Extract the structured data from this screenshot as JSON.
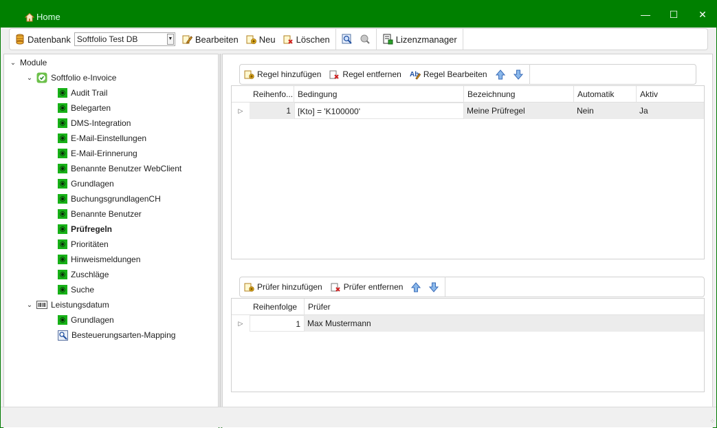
{
  "window": {
    "title": "Home",
    "minimize": "—",
    "maximize": "☐",
    "close": "✕"
  },
  "toolbar": {
    "datenbank_label": "Datenbank",
    "db_value": "Softfolio Test DB",
    "bearbeiten": "Bearbeiten",
    "neu": "Neu",
    "loeschen": "Löschen",
    "lizenzmanager": "Lizenzmanager"
  },
  "tree": {
    "root": "Module",
    "group1": "Softfolio e-Invoice",
    "items1": [
      "Audit Trail",
      "Belegarten",
      "DMS-Integration",
      "E-Mail-Einstellungen",
      "E-Mail-Erinnerung",
      "Benannte Benutzer WebClient",
      "Grundlagen",
      "BuchungsgrundlagenCH",
      "Benannte Benutzer",
      "Prüfregeln",
      "Prioritäten",
      "Hinweismeldungen",
      "Zuschläge",
      "Suche"
    ],
    "selected": "Prüfregeln",
    "group2": "Leistungsdatum",
    "items2": [
      "Grundlagen",
      "Besteuerungsarten-Mapping"
    ]
  },
  "rules": {
    "toolbar": {
      "add": "Regel hinzufügen",
      "remove": "Regel entfernen",
      "edit": "Regel Bearbeiten"
    },
    "columns": [
      "Reihenfo...",
      "Bedingung",
      "Bezeichnung",
      "Automatik",
      "Aktiv"
    ],
    "rows": [
      {
        "order": "1",
        "condition": "[Kto] = 'K100000'",
        "name": "Meine Prüfregel",
        "auto": "Nein",
        "active": "Ja"
      }
    ]
  },
  "checkers": {
    "toolbar": {
      "add": "Prüfer hinzufügen",
      "remove": "Prüfer entfernen"
    },
    "columns": [
      "Reihenfolge",
      "Prüfer"
    ],
    "rows": [
      {
        "order": "1",
        "name": "Max Mustermann"
      }
    ]
  },
  "colors": {
    "titlebar": "#008000",
    "node_icon": "#17b117",
    "arrow_blue": "#5a8fd8"
  }
}
